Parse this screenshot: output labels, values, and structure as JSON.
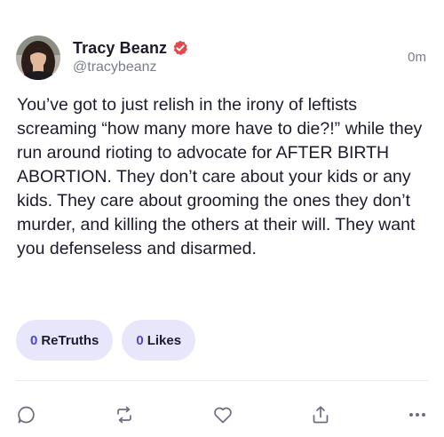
{
  "author": {
    "display_name": "Tracy Beanz",
    "handle": "@tracybeanz",
    "verified": true,
    "avatar_icon": "profile-photo"
  },
  "timestamp": "0m",
  "body": "You’ve got to just relish in the irony of leftists screaming “how many more have to die?!” while they run around rioting to advocate for AFTER BIRTH ABORTION. They don’t care about your kids or any kids. They care about grooming the ones they don’t murder, and killing the others at their will. They want you defenseless and disarmed.",
  "stats": {
    "retruths_count": "0",
    "retruths_label": "ReTruths",
    "likes_count": "0",
    "likes_label": "Likes"
  },
  "actions": [
    {
      "name": "reply",
      "icon": "comment-icon"
    },
    {
      "name": "retruth",
      "icon": "repost-icon"
    },
    {
      "name": "like",
      "icon": "heart-icon"
    },
    {
      "name": "share",
      "icon": "share-icon"
    },
    {
      "name": "more",
      "icon": "more-icon"
    }
  ],
  "colors": {
    "accent": "#4b45d6",
    "pill_bg": "#e8e6fb",
    "verified": "#e5454b",
    "muted": "#7a7d8c"
  }
}
